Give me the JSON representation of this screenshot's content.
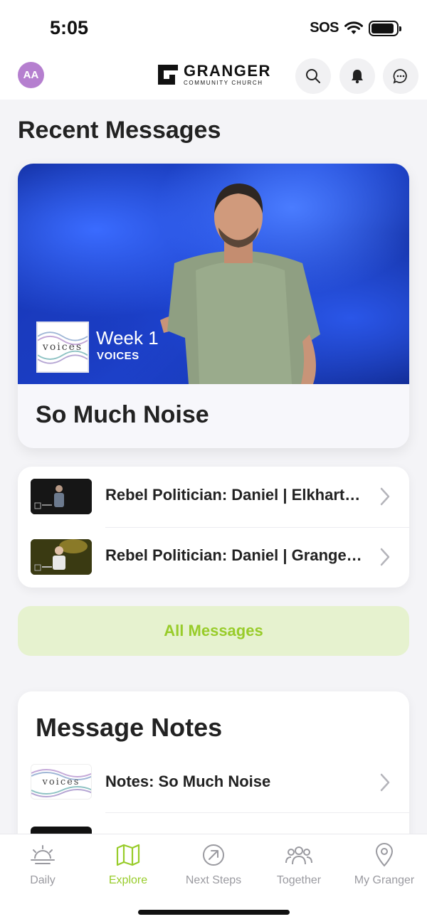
{
  "status": {
    "time": "5:05",
    "sos": "SOS",
    "battery_level": 0.9
  },
  "header": {
    "avatar_initials": "AA",
    "logo_name": "GRANGER",
    "logo_sub": "COMMUNITY CHURCH",
    "icons": [
      "search-icon",
      "bell-icon",
      "chat-icon"
    ]
  },
  "recent": {
    "title": "Recent Messages",
    "hero": {
      "thumb_text": "voices",
      "week": "Week 1",
      "series": "VOICES",
      "title": "So Much Noise"
    },
    "items": [
      {
        "label": "Rebel Politician: Daniel | Elkhart…"
      },
      {
        "label": "Rebel Politician: Daniel | Grange…"
      }
    ],
    "all_button": "All Messages"
  },
  "notes": {
    "title": "Message Notes",
    "items": [
      {
        "thumb_text": "voices",
        "label": "Notes: So Much Noise"
      }
    ]
  },
  "tabs": [
    {
      "label": "Daily",
      "icon": "sunrise-icon",
      "active": false
    },
    {
      "label": "Explore",
      "icon": "map-icon",
      "active": true
    },
    {
      "label": "Next Steps",
      "icon": "arrow-circle-icon",
      "active": false
    },
    {
      "label": "Together",
      "icon": "people-icon",
      "active": false
    },
    {
      "label": "My Granger",
      "icon": "location-pin-icon",
      "active": false
    }
  ],
  "colors": {
    "accent": "#98cc2a",
    "accent_bg": "#e6f2cf",
    "avatar": "#b57fcf"
  }
}
